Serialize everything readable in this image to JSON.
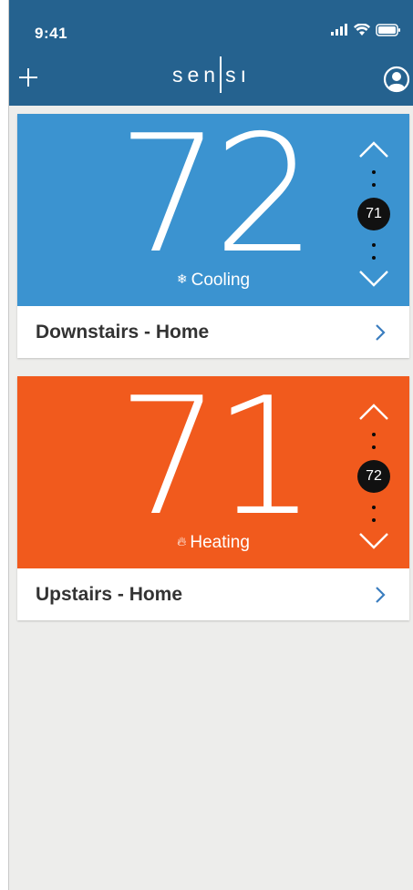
{
  "status_bar": {
    "time": "9:41",
    "icons": [
      "signal-icon",
      "wifi-icon",
      "battery-icon"
    ]
  },
  "header": {
    "logo_left": "sen",
    "logo_right": "sı",
    "add_icon": "plus-icon",
    "profile_icon": "user-profile-icon"
  },
  "thermostats": [
    {
      "name": "Downstairs - Home",
      "current_temp": "72",
      "mode_label": "Cooling",
      "mode_icon": "snowflake-icon",
      "setpoint": "71",
      "color": "#3b93d0"
    },
    {
      "name": "Upstairs - Home",
      "current_temp": "71",
      "mode_label": "Heating",
      "mode_icon": "flame-icon",
      "setpoint": "72",
      "color": "#f15a1d"
    }
  ],
  "colors": {
    "header": "#25628f",
    "background": "#ededeb",
    "chevron": "#3a7dbf"
  }
}
